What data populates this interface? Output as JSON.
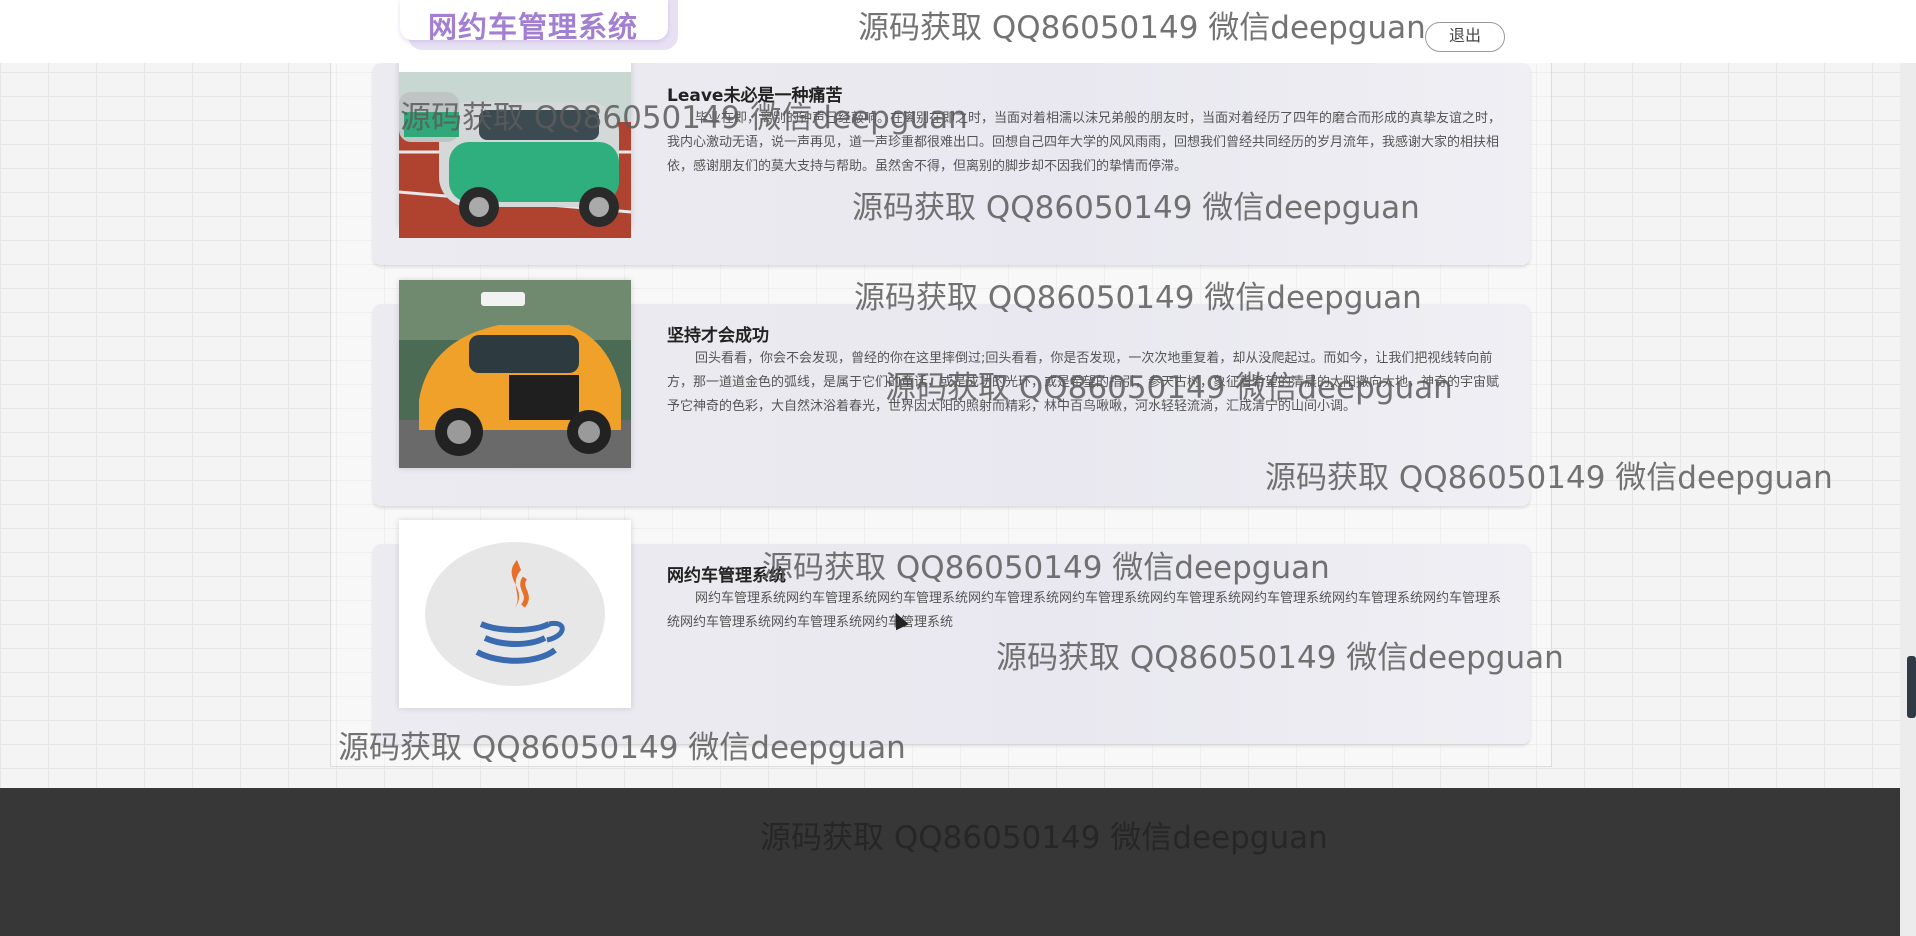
{
  "header": {
    "logo_text": "网约车管理系统",
    "logout_label": "退出"
  },
  "watermark_text": "源码获取 QQ86050149 微信deepguan",
  "articles": [
    {
      "title": "Leave未必是一种痛苦",
      "body": "毕业在即，离别的钟声已经敲响。在离别在即之时，当面对着相濡以沫兄弟般的朋友时，当面对着经历了四年的磨合而形成的真挚友谊之时，我内心激动无语，说一声再见，道一声珍重都很难出口。回想自己四年大学的风风雨雨，回想我们曾经共同经历的岁月流年，我感谢大家的相扶相依，感谢朋友们的莫大支持与帮助。虽然舍不得，但离别的脚步却不因我们的挚情而停滞。",
      "image": "green-white-taxi-photo"
    },
    {
      "title": "坚持才会成功",
      "body": "回头看看，你会不会发现，曾经的你在这里摔倒过;回头看看，你是否发现，一次次地重复着，却从没爬起过。而如今，让我们把视线转向前方，那一道道金色的弧线，是属于它们的童话，或是成功的光环，或是希望的指引，参天古树，象征着希望的清晨的太阳撒向大地，神奇的宇宙赋予它神奇的色彩，大自然沐浴着春光，世界因太阳的照射而精彩，林中百鸟啾啾，河水轻轻流淌，汇成清宁的山间小调。",
      "image": "orange-taxi-photo"
    },
    {
      "title": "网约车管理系统",
      "body": "网约车管理系统网约车管理系统网约车管理系统网约车管理系统网约车管理系统网约车管理系统网约车管理系统网约车管理系统网约车管理系统网约车管理系统网约车管理系统网约车管理系统",
      "image": "java-logo"
    }
  ]
}
